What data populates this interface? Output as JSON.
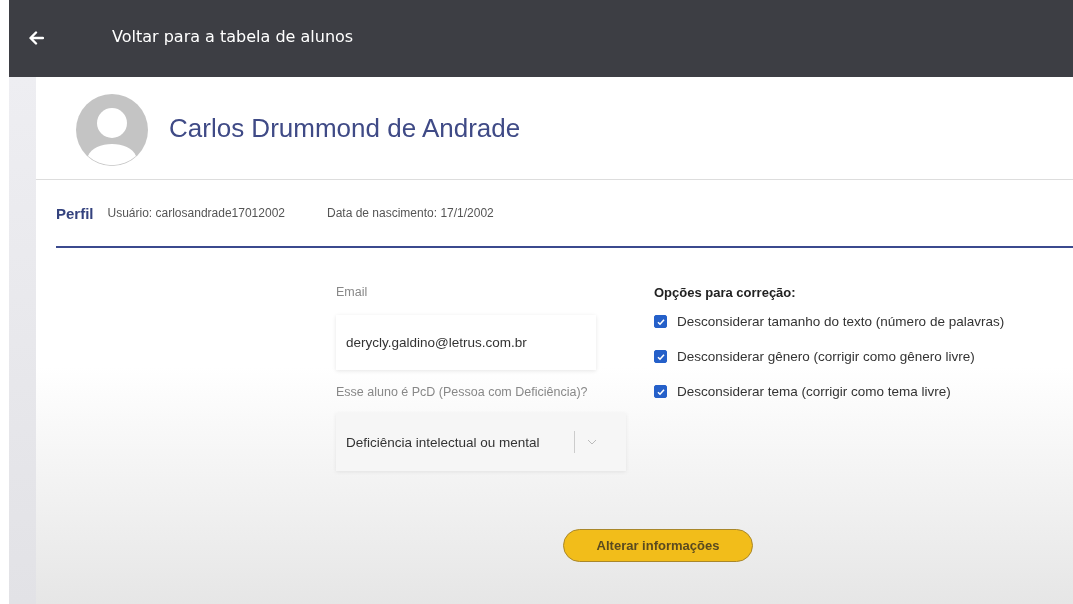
{
  "top_bar": {
    "back_label": "Voltar para a tabela de alunos"
  },
  "student": {
    "name": "Carlos Drummond de Andrade"
  },
  "profile": {
    "tab": "Perfil",
    "username": "Usuário: carlosandrade17012002",
    "birth_date": "Data de nascimento: 17/1/2002"
  },
  "form": {
    "email_label": "Email",
    "email_value": "derycly.galdino@letrus.com.br",
    "pcd_label": "Esse aluno é PcD (Pessoa com Deficiência)?",
    "pcd_value": "Deficiência intelectual ou mental"
  },
  "options": {
    "title": "Opções para correção:",
    "items": [
      {
        "label": "Desconsiderar tamanho do texto (número de palavras)",
        "checked": true
      },
      {
        "label": "Desconsiderar gênero (corrigir como gênero livre)",
        "checked": true
      },
      {
        "label": "Desconsiderar tema (corrigir como tema livre)",
        "checked": true
      }
    ]
  },
  "buttons": [
    "Alterar informações"
  ]
}
